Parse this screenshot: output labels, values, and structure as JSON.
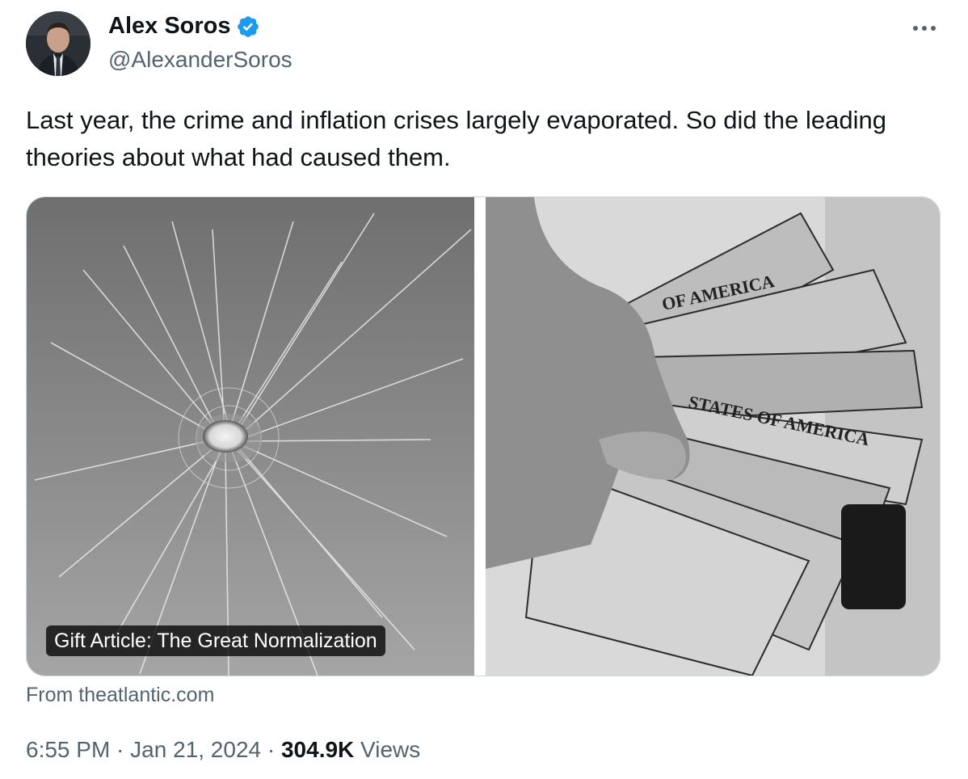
{
  "author": {
    "name": "Alex Soros",
    "handle": "@AlexanderSoros",
    "verified_color": "#1d9bf0"
  },
  "tweet": {
    "text": "Last year, the crime and inflation crises largely evaporated. So did the leading theories about what had caused them."
  },
  "media": {
    "left_image": "cracked-glass-bullet-hole-photo",
    "right_image": "hand-holding-dollar-bills-photo",
    "caption": "Gift Article: The Great Normalization"
  },
  "link": {
    "source": "From theatlantic.com"
  },
  "meta": {
    "time": "6:55 PM",
    "sep1": " · ",
    "date": "Jan 21, 2024",
    "sep2": " · ",
    "views_count": "304.9K",
    "views_label": " Views"
  },
  "colors": {
    "text_primary": "#0f1419",
    "text_secondary": "#536471",
    "border": "#cfd9de",
    "accent": "#1d9bf0"
  }
}
